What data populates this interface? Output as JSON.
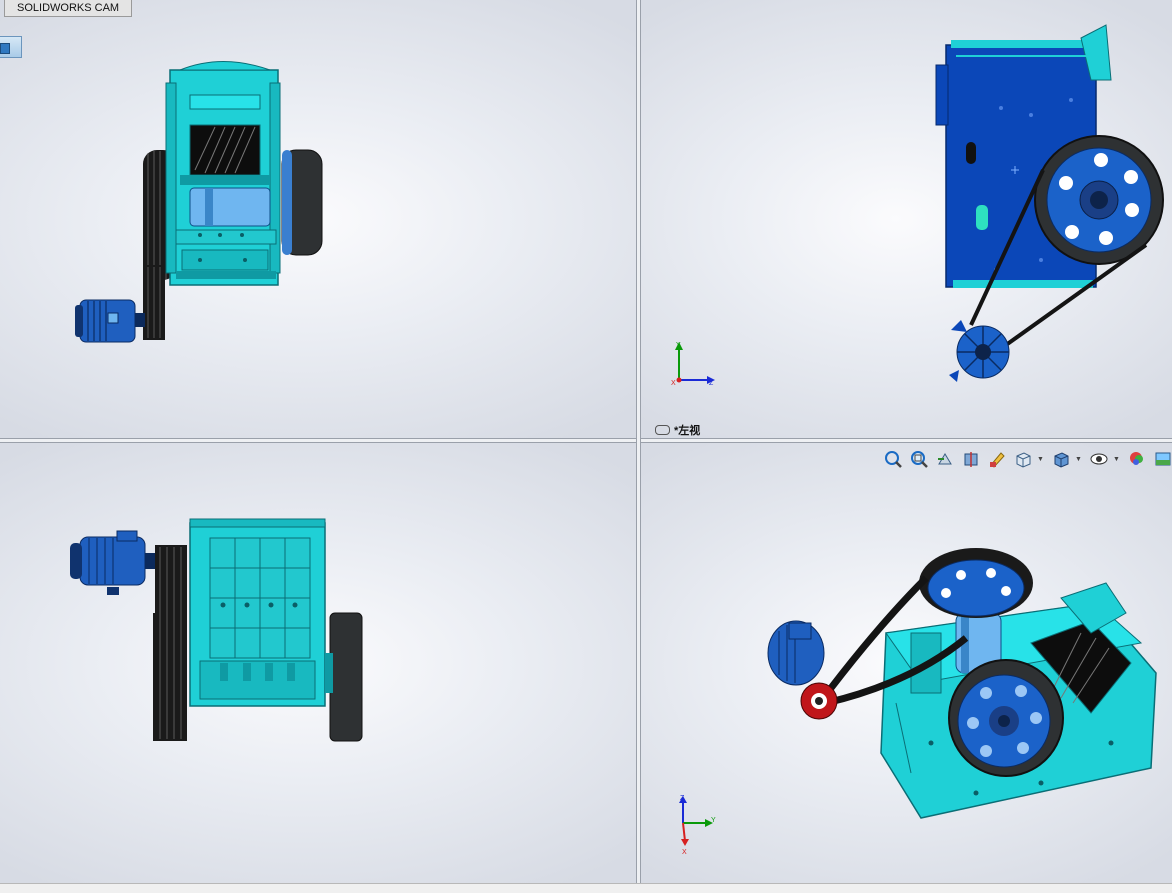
{
  "app": {
    "command_tab": "SOLIDWORKS CAM"
  },
  "viewports": {
    "top_right": {
      "view_name": "*左视"
    }
  },
  "triads": {
    "top_right": {
      "up": "Y",
      "right": "Z",
      "origin": "X"
    },
    "bottom_right": {
      "up": "Z",
      "right": "Y",
      "down": "X"
    }
  },
  "heads_up_toolbar": {
    "tools": [
      "zoom-to-fit-icon",
      "zoom-to-area-icon",
      "previous-view-icon",
      "section-view-icon",
      "dynamic-annotation-icon",
      "view-orientation-icon",
      "display-style-icon",
      "hide-show-items-icon",
      "edit-appearance-icon",
      "apply-scene-icon"
    ]
  },
  "colors": {
    "frame": "#1fd0d6",
    "frame_dark": "#0c8f98",
    "side_panel": "#0b47b8",
    "motor": "#1f5fbf",
    "wheel": "#2e3133",
    "belt": "#1a1a1a",
    "rotor": "#6fb6f0"
  }
}
